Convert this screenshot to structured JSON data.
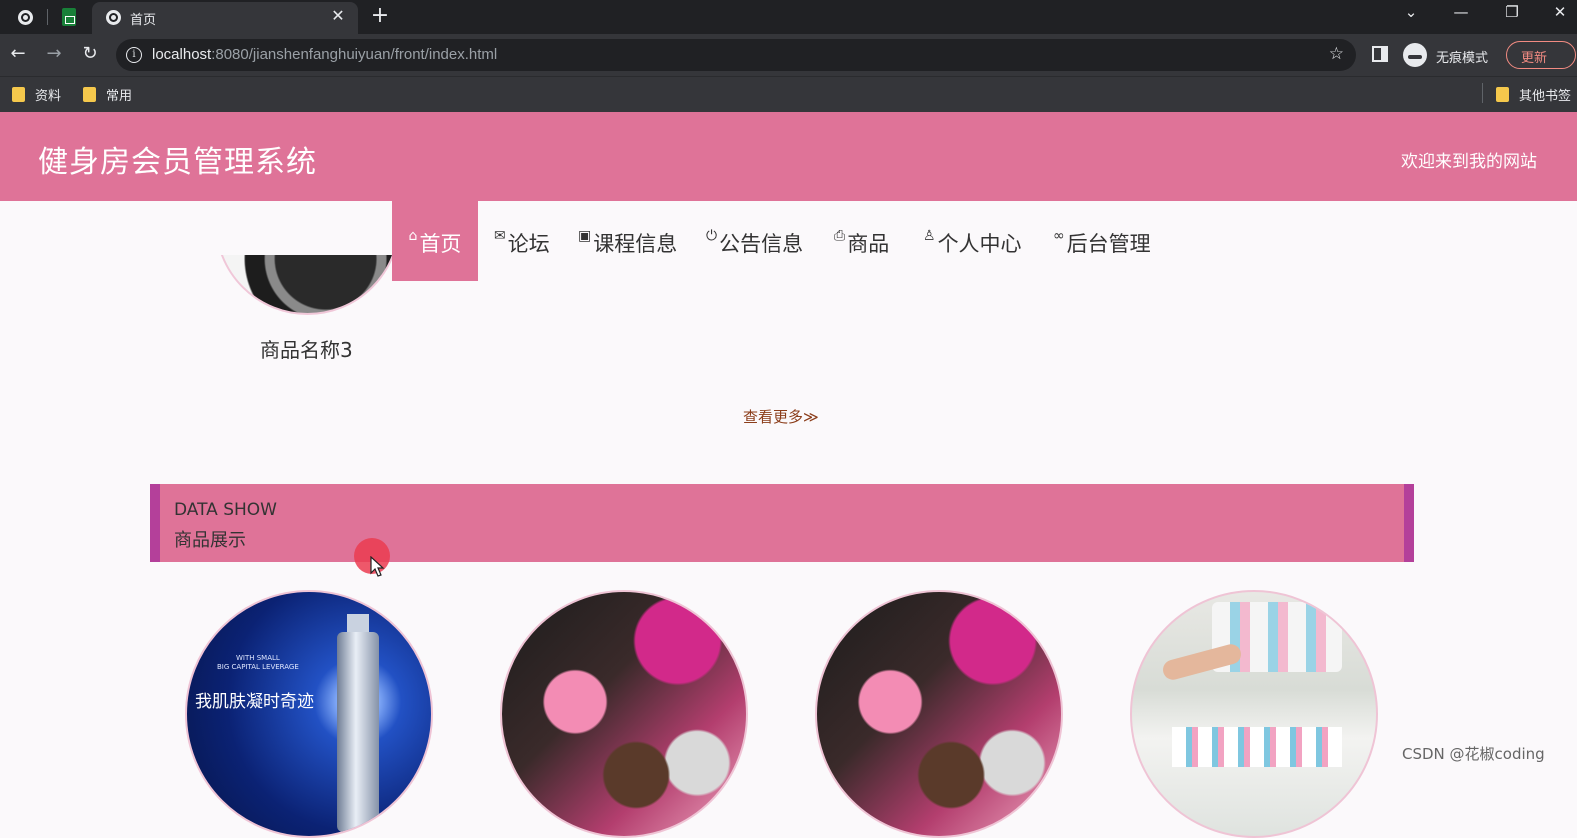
{
  "browser": {
    "tab_title": "首页",
    "url_host": "localhost",
    "url_rest": ":8080/jianshenfanghuiyuan/front/index.html",
    "incognito_label": "无痕模式",
    "update_label": "更新",
    "bookmarks": [
      "资料",
      "常用",
      "其他书签"
    ]
  },
  "site": {
    "title": "健身房会员管理系统",
    "welcome": "欢迎来到我的网站"
  },
  "nav": {
    "items": [
      {
        "label": "首页",
        "icon": "home-icon"
      },
      {
        "label": "论坛",
        "icon": "mail-icon"
      },
      {
        "label": "课程信息",
        "icon": "gift-icon"
      },
      {
        "label": "公告信息",
        "icon": "power-icon"
      },
      {
        "label": "商品",
        "icon": "print-icon"
      },
      {
        "label": "个人中心",
        "icon": "user-icon"
      },
      {
        "label": "后台管理",
        "icon": "link-icon"
      }
    ],
    "active_index": 0
  },
  "previous_section": {
    "product_name": "商品名称3",
    "see_more": "查看更多≫"
  },
  "section": {
    "en_title": "DATA SHOW",
    "cn_title": "商品展示"
  },
  "products": {
    "item1_text": "我肌肤凝时奇迹",
    "item1_small": "WITH SMALL\nBIG CAPITAL LEVERAGE"
  },
  "watermark": "CSDN @花椒coding",
  "colors": {
    "primary": "#df7398",
    "accent_border": "#b4409a",
    "see_more": "#8b3d1a"
  }
}
